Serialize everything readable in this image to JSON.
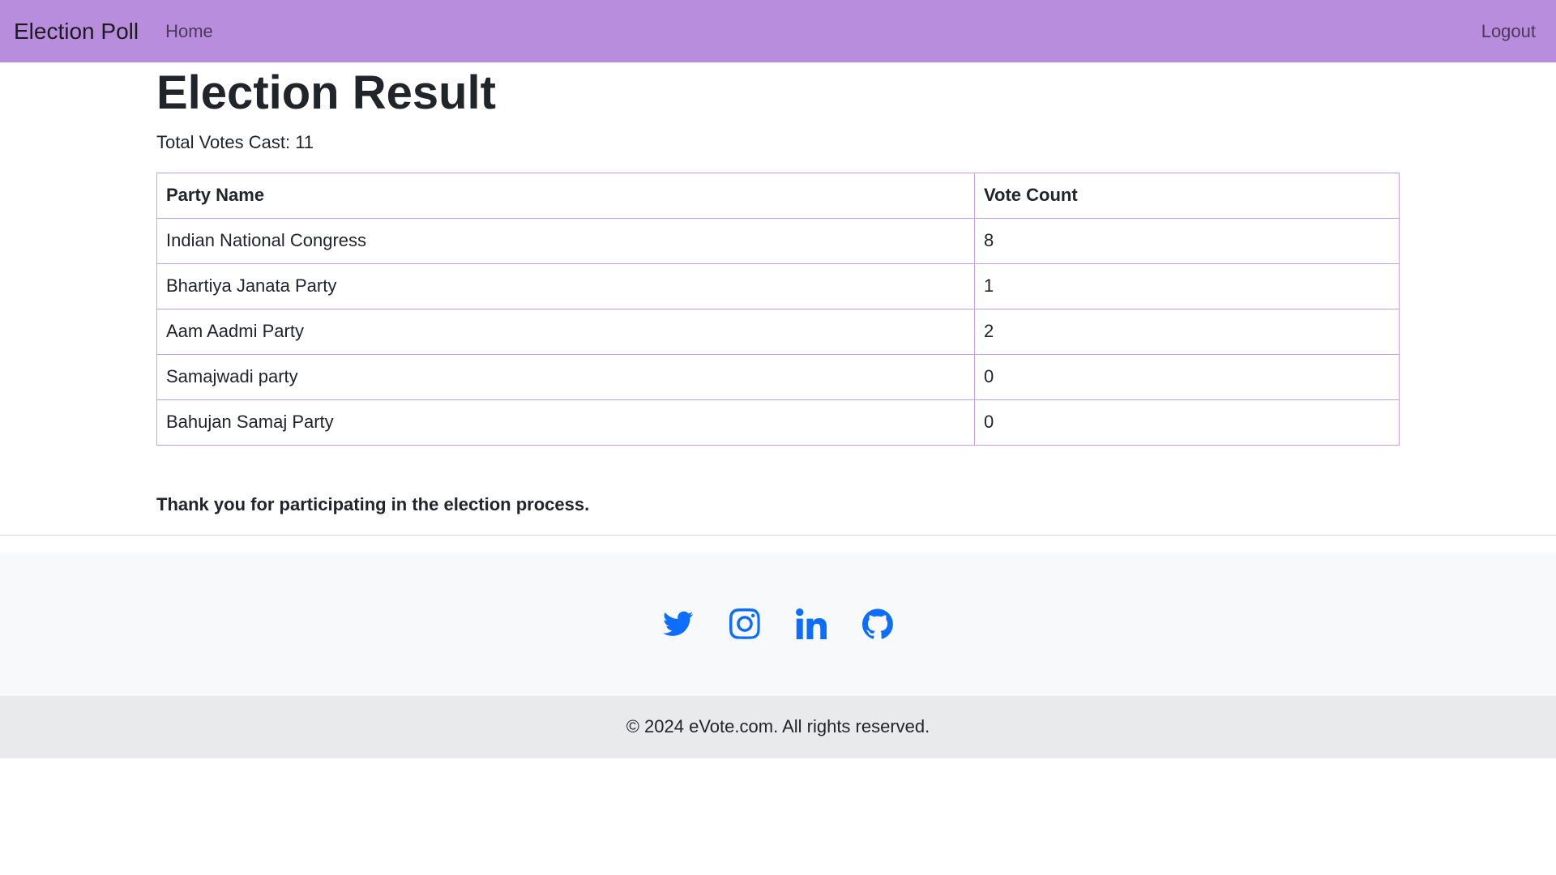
{
  "navbar": {
    "brand": "Election Poll",
    "home_label": "Home",
    "logout_label": "Logout"
  },
  "main": {
    "title": "Election Result",
    "total_votes_text": "Total Votes Cast: 11",
    "table": {
      "headers": [
        "Party Name",
        "Vote Count"
      ],
      "rows": [
        {
          "party": "Indian National Congress",
          "votes": "8"
        },
        {
          "party": "Bhartiya Janata Party",
          "votes": "1"
        },
        {
          "party": "Aam Aadmi Party",
          "votes": "2"
        },
        {
          "party": "Samajwadi party",
          "votes": "0"
        },
        {
          "party": "Bahujan Samaj Party",
          "votes": "0"
        }
      ]
    },
    "thank_you": "Thank you for participating in the election process."
  },
  "footer": {
    "social_icons": [
      "twitter-icon",
      "instagram-icon",
      "linkedin-icon",
      "github-icon"
    ],
    "icon_color": "#0d6efd",
    "copyright": "© 2024 eVote.com. All rights reserved."
  },
  "colors": {
    "navbar_bg": "#b88ddd",
    "table_border": "#c9a3de"
  }
}
